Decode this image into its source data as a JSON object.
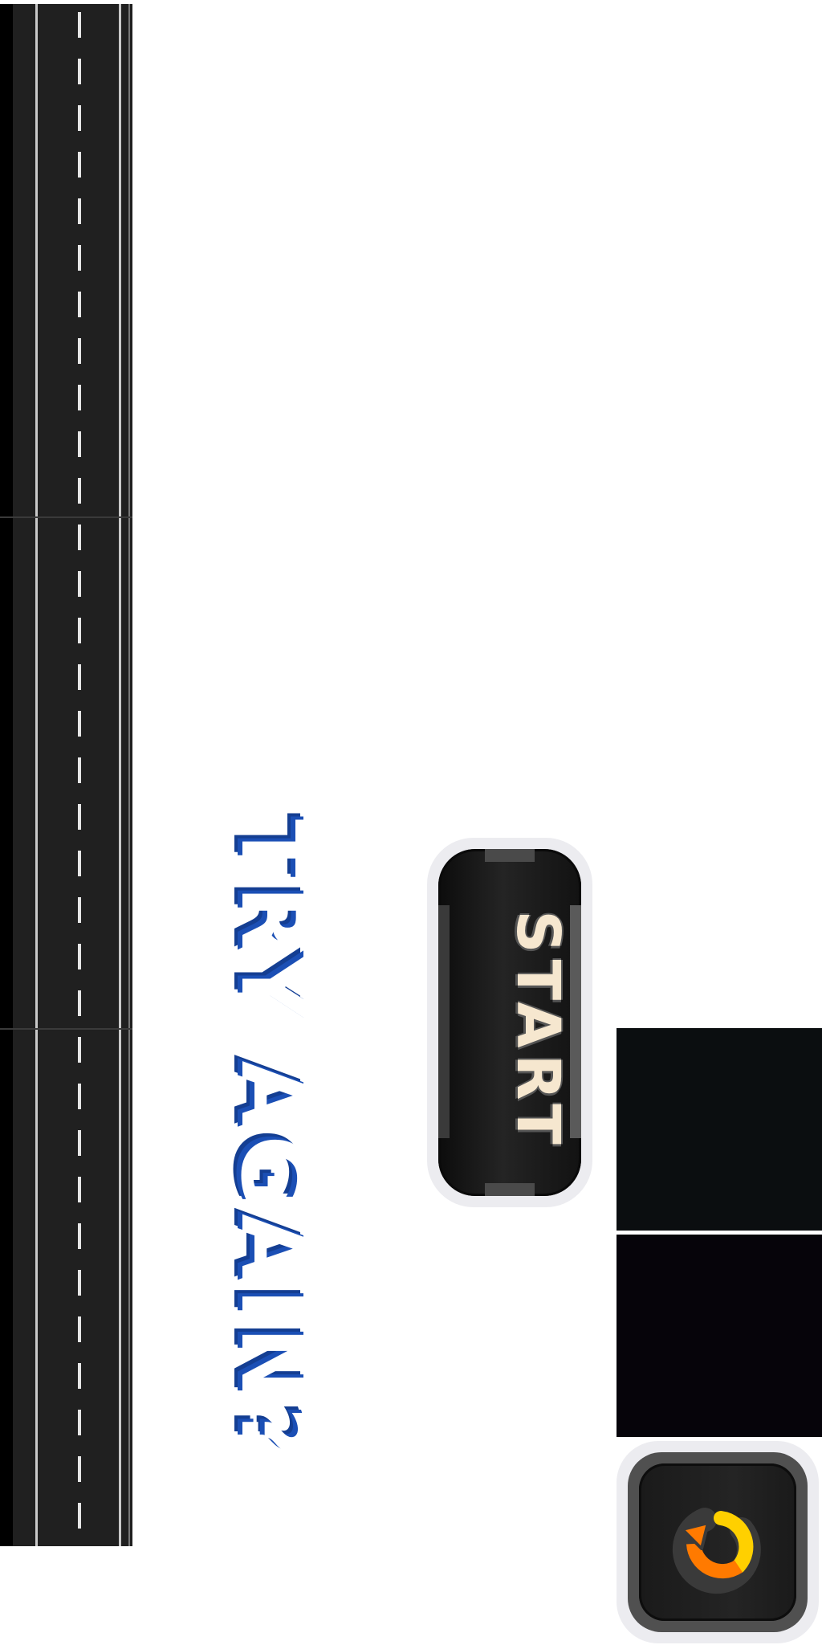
{
  "title": "TRY AGAIN?",
  "start_button": {
    "label": "START"
  },
  "restart_button": {
    "icon": "restart-arrow-icon"
  },
  "colors": {
    "title_fill": "#ffffff",
    "title_shadow": "#1b4fb5",
    "road": "#202020",
    "lane_marking": "#e6e6e6",
    "button_frame": "#ececf0",
    "button_body": "#1a1a1a",
    "start_text": "#f6e7cf",
    "icon_orange": "#ff7a00",
    "icon_yellow": "#ffd000"
  }
}
